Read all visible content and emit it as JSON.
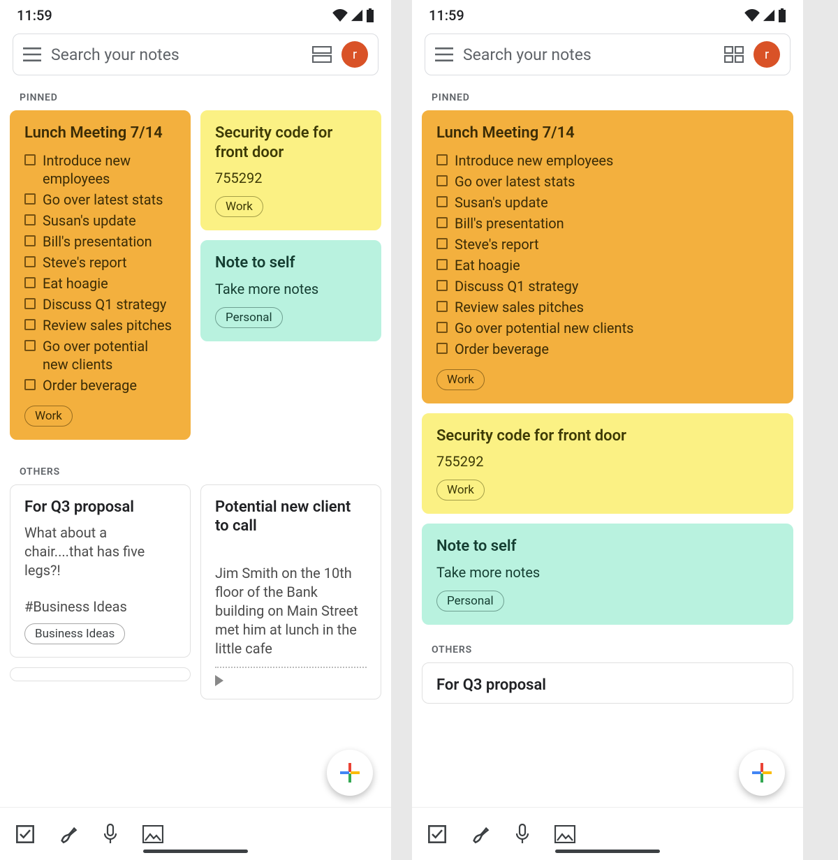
{
  "status": {
    "time": "11:59"
  },
  "search": {
    "placeholder": "Search your notes",
    "avatar_letter": "r"
  },
  "sections": {
    "pinned": "PINNED",
    "others": "OTHERS"
  },
  "notes": {
    "lunch": {
      "title": "Lunch Meeting 7/14",
      "items": [
        "Introduce new employees",
        "Go over latest stats",
        "Susan's update",
        "Bill's presentation",
        "Steve's report",
        "Eat hoagie",
        "Discuss Q1 strategy",
        "Review sales pitches",
        "Go over potential new clients",
        "Order beverage"
      ],
      "tag": "Work"
    },
    "security": {
      "title": "Security code for front door",
      "body": "755292",
      "tag": "Work"
    },
    "self": {
      "title": "Note to self",
      "body": "Take more notes",
      "tag": "Personal"
    },
    "q3": {
      "title": "For Q3 proposal",
      "body": "What about a chair....that has five legs?!",
      "extra": "#Business Ideas",
      "tag": "Business Ideas"
    },
    "client": {
      "title": "Potential new client to call",
      "body": "Jim Smith on the 10th floor of the Bank building on Main Street met him at lunch in the little cafe"
    }
  }
}
